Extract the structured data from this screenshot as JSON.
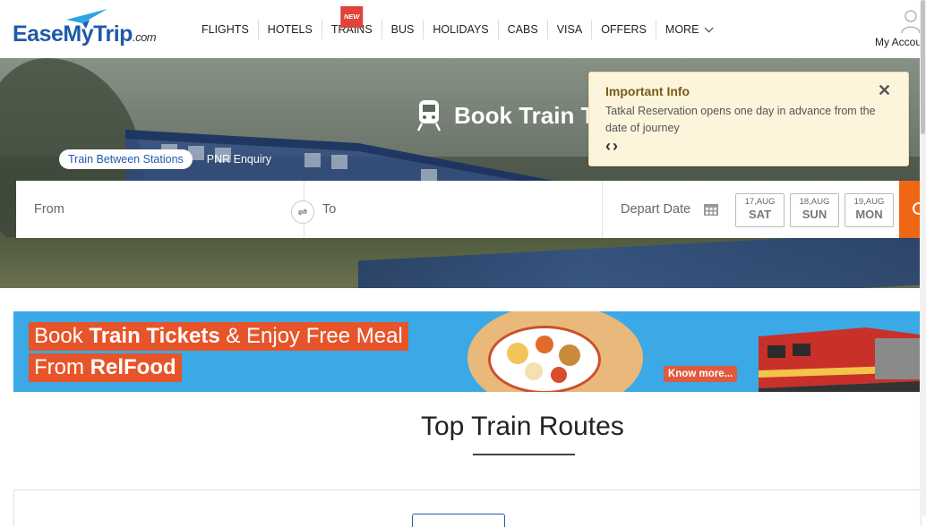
{
  "header": {
    "logo_main": "EaseMyTrip",
    "logo_suffix": ".com",
    "nav": [
      {
        "label": "FLIGHTS"
      },
      {
        "label": "HOTELS"
      },
      {
        "label": "TRAINS",
        "badge": "NEW"
      },
      {
        "label": "BUS"
      },
      {
        "label": "HOLIDAYS"
      },
      {
        "label": "CABS"
      },
      {
        "label": "VISA"
      },
      {
        "label": "OFFERS"
      },
      {
        "label": "MORE"
      }
    ],
    "account_label": "My Account"
  },
  "hero": {
    "title": "Book Train T",
    "tabs": [
      "Train Between Stations",
      "PNR Enquiry"
    ],
    "search": {
      "from_label": "From",
      "to_label": "To",
      "depart_label": "Depart Date",
      "dates": [
        {
          "date": "17,AUG",
          "day": "SAT"
        },
        {
          "date": "18,AUG",
          "day": "SUN"
        },
        {
          "date": "19,AUG",
          "day": "MON"
        }
      ]
    }
  },
  "info": {
    "title": "Important Info",
    "text": "Tatkal Reservation opens one day in advance from the date of journey",
    "arrows": "‹›"
  },
  "banner": {
    "line1_pre": "Book ",
    "line1_bold": "Train Tickets",
    "line1_post": " & Enjoy Free Meal",
    "line2_pre": "From ",
    "line2_bold": "RelFood",
    "cta": "Know more..."
  },
  "routes": {
    "title": "Top Train Routes"
  },
  "colors": {
    "brand_blue": "#1f5aa8",
    "accent_orange": "#ef6614",
    "banner_blue": "#3aa9e5",
    "banner_red": "#e8542a",
    "info_bg": "#fdf4dc"
  }
}
